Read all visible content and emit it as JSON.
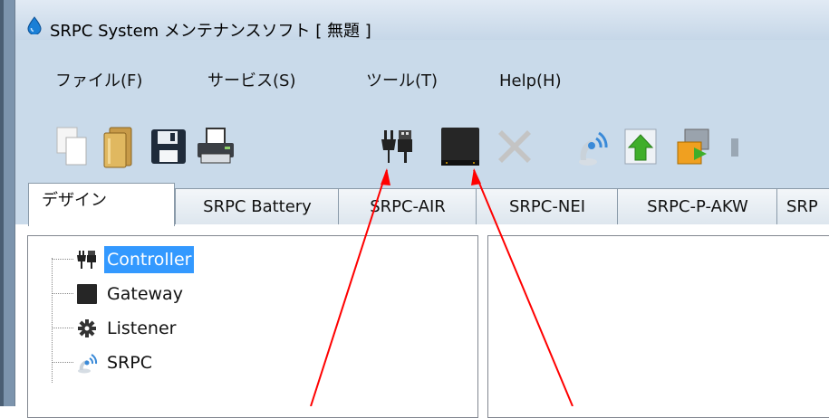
{
  "window": {
    "title": "SRPC System メンテナンスソフト [ 無題 ]"
  },
  "menu": [
    {
      "label": "ファイル(F)"
    },
    {
      "label": "サービス(S)"
    },
    {
      "label": "ツール(T)"
    },
    {
      "label": "Help(H)"
    }
  ],
  "toolbar": {
    "buttons": [
      {
        "icon": "new-document-icon"
      },
      {
        "icon": "open-folder-icon"
      },
      {
        "icon": "save-icon"
      },
      {
        "icon": "print-icon"
      },
      {
        "icon": "controller-plug-icon"
      },
      {
        "icon": "gateway-device-icon"
      },
      {
        "icon": "delete-icon",
        "disabled": true
      },
      {
        "icon": "srpc-antenna-icon"
      },
      {
        "icon": "upload-icon"
      },
      {
        "icon": "export-icon"
      }
    ]
  },
  "tabs": [
    {
      "label": "デザイン",
      "active": true
    },
    {
      "label": "SRPC Battery"
    },
    {
      "label": "SRPC-AIR"
    },
    {
      "label": "SRPC-NEI"
    },
    {
      "label": "SRPC-P-AKW"
    },
    {
      "label": "SRP"
    }
  ],
  "tree": {
    "items": [
      {
        "label": "Controller",
        "icon": "controller-plug-icon",
        "selected": true
      },
      {
        "label": "Gateway",
        "icon": "gateway-device-icon"
      },
      {
        "label": "Listener",
        "icon": "gear-icon"
      },
      {
        "label": "SRPC",
        "icon": "srpc-antenna-icon"
      }
    ]
  },
  "colors": {
    "selection": "#3399ff",
    "annotation_arrow": "#ff0000",
    "window_frame": "#c9daea"
  }
}
